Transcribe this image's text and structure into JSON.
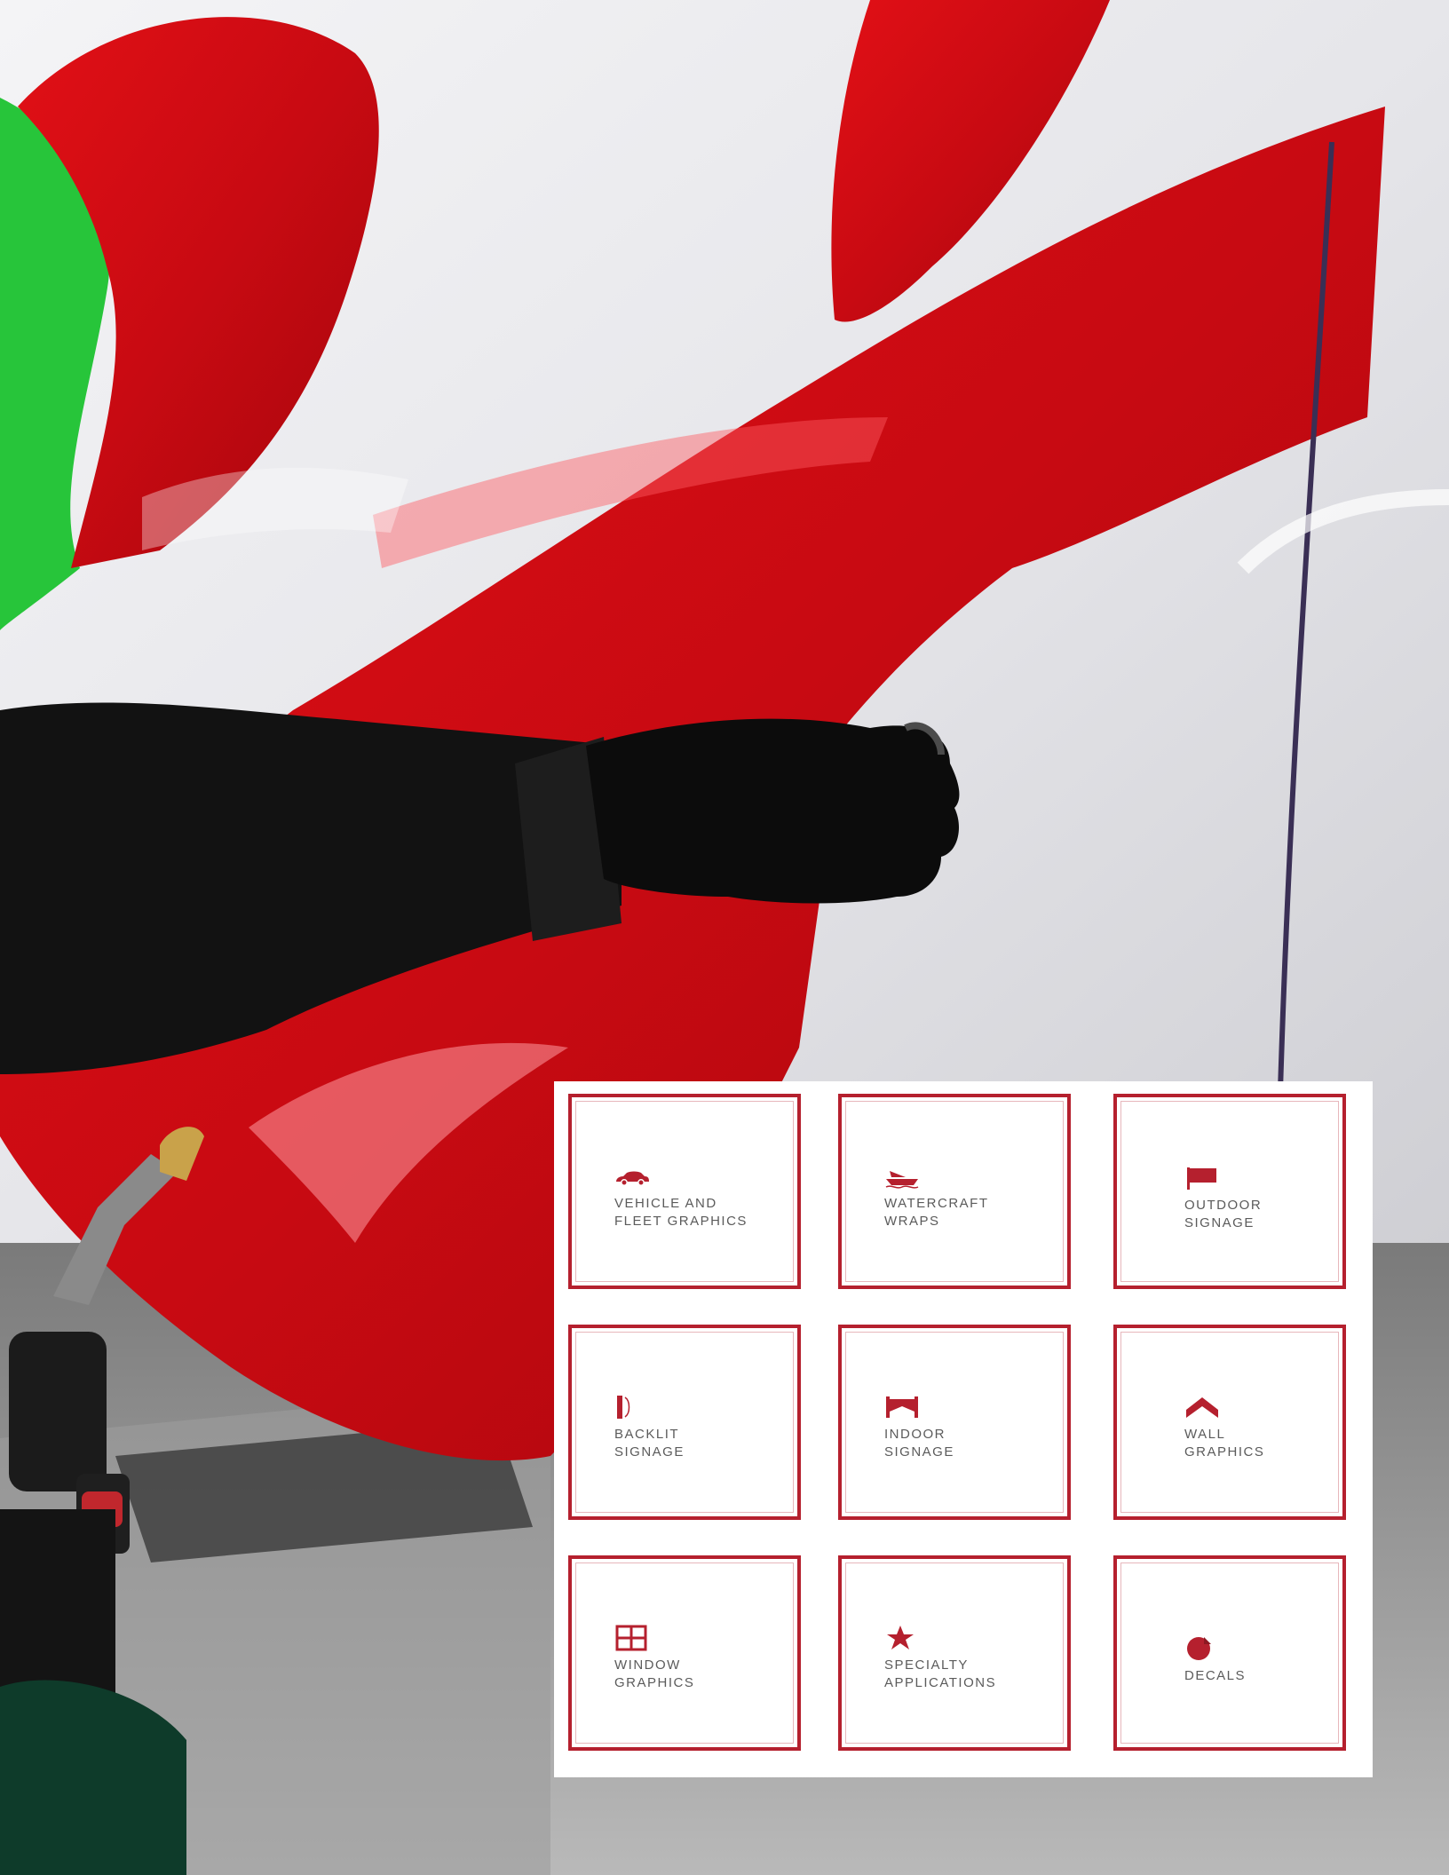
{
  "colors": {
    "accent": "#b5202e",
    "label_text": "#5b5b5b",
    "panel_bg": "#ffffff"
  },
  "services": [
    {
      "label": "Vehicle and\nFleet Graphics",
      "icon": "car-icon"
    },
    {
      "label": "Watercraft\nWraps",
      "icon": "boat-icon"
    },
    {
      "label": "Outdoor\nSignage",
      "icon": "flag-icon"
    },
    {
      "label": "Backlit\nSignage",
      "icon": "backlit-icon"
    },
    {
      "label": "Indoor\nSignage",
      "icon": "banner-icon"
    },
    {
      "label": "Wall\nGraphics",
      "icon": "chevron-up-icon"
    },
    {
      "label": "Window\nGraphics",
      "icon": "window-icon"
    },
    {
      "label": "Specialty\nApplications",
      "icon": "star-icon"
    },
    {
      "label": "Decals",
      "icon": "decal-icon"
    }
  ]
}
